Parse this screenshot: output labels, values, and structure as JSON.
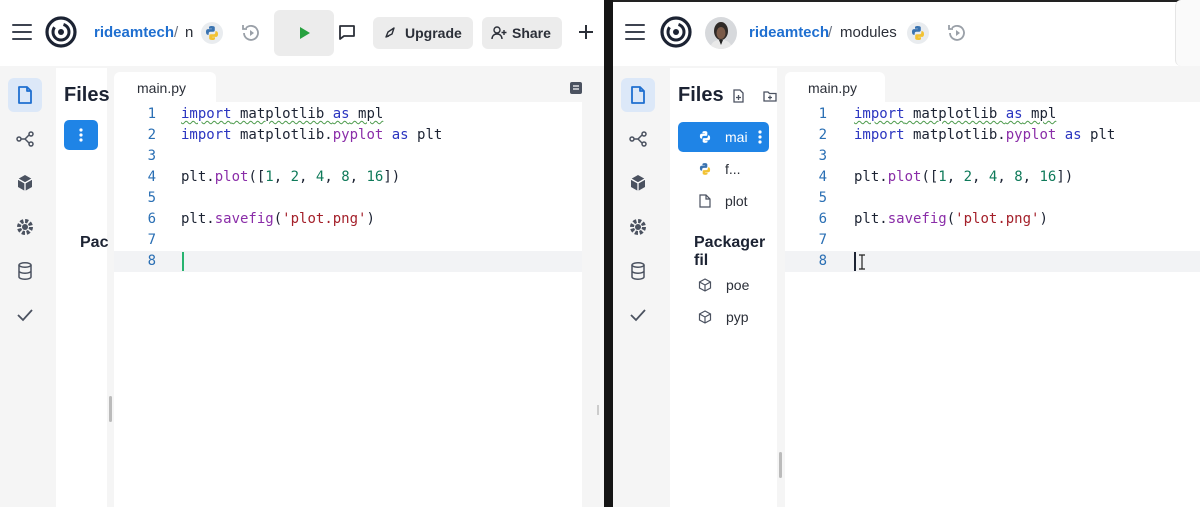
{
  "left": {
    "breadcrumb": {
      "user": "rideamtech",
      "separator": "/",
      "repl": "n"
    },
    "upgrade_label": "Upgrade",
    "share_label": "Share",
    "files_title": "Files",
    "packager_title": "Pac",
    "tab": "main.py"
  },
  "right": {
    "breadcrumb": {
      "user": "rideamtech",
      "separator": "/",
      "repl": "modules"
    },
    "files_title": "Files",
    "files": [
      "mai",
      "f...",
      "plot"
    ],
    "packager_title": "Packager fil",
    "packages": [
      "poe",
      "pyp"
    ],
    "tab": "main.py"
  },
  "code": {
    "line_numbers": [
      "1",
      "2",
      "3",
      "4",
      "5",
      "6",
      "7",
      "8"
    ],
    "l1": {
      "kw1": "import",
      "rest1": " matplotlib ",
      "kw2": "as",
      "rest2": " mpl"
    },
    "l2": {
      "kw1": "import",
      "mod": " matplotlib.",
      "fn": "pyplot",
      "sp": " ",
      "kw2": "as",
      "rest": " plt"
    },
    "l4": {
      "a": "plt.",
      "fn": "plot",
      "b": "([",
      "n1": "1",
      "c1": ", ",
      "n2": "2",
      "c2": ", ",
      "n3": "4",
      "c3": ", ",
      "n4": "8",
      "c4": ", ",
      "n5": "16",
      "d": "])"
    },
    "l6": {
      "a": "plt.",
      "fn": "savefig",
      "b": "(",
      "s": "'plot.png'",
      "c": ")"
    }
  },
  "colors": {
    "accent": "#1f84e6",
    "run": "#27a13f",
    "link": "#1f6fd0"
  }
}
